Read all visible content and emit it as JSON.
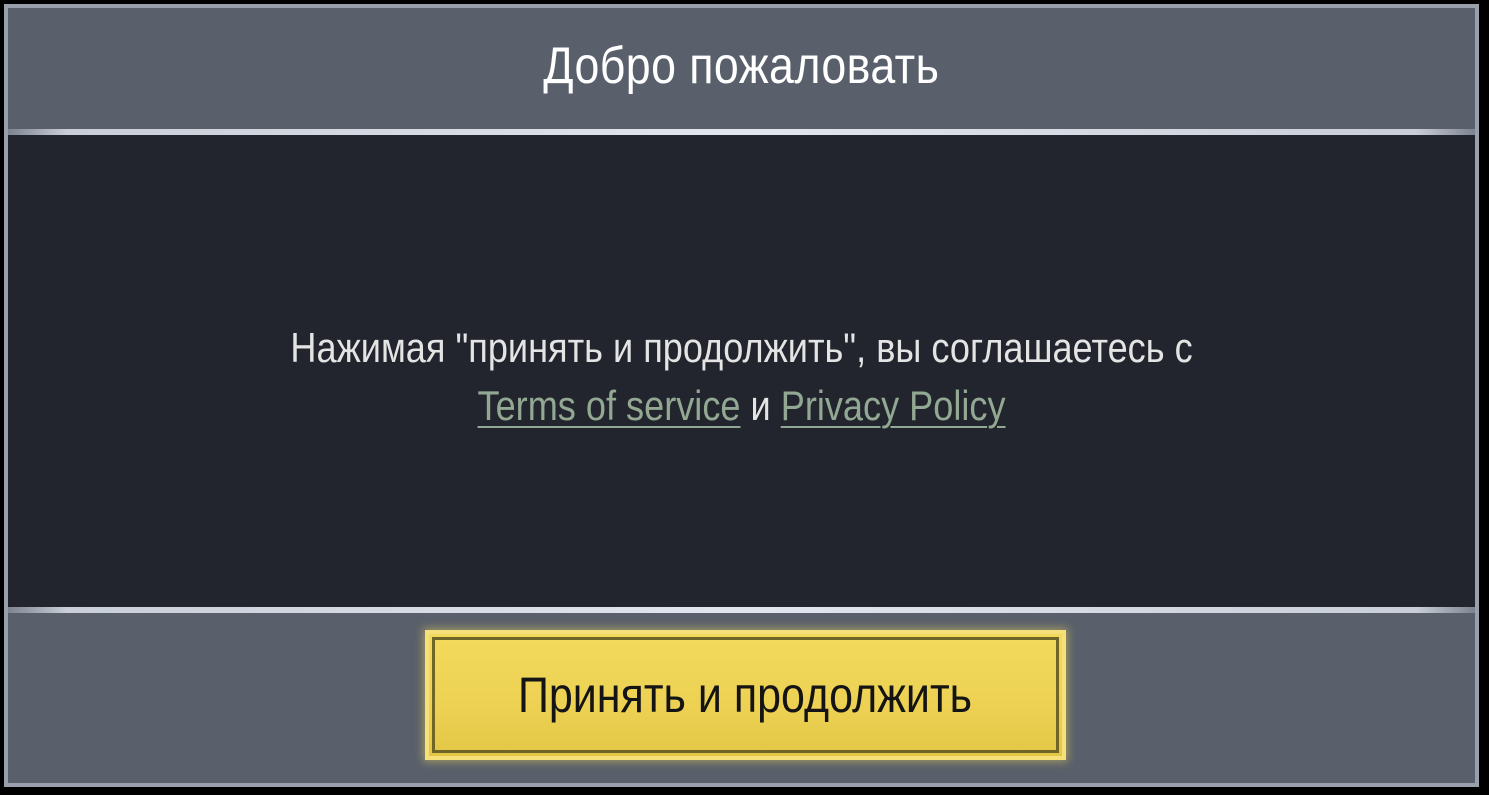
{
  "dialog": {
    "title": "Добро пожаловать",
    "message_prefix": "Нажимая \"принять и продолжить\", вы соглашаетесь с",
    "terms_link": "Terms of service",
    "conjunction": "и",
    "privacy_link": "Privacy Policy",
    "accept_button": "Принять и продолжить"
  },
  "colors": {
    "header_bg": "#5a606b",
    "body_bg": "#22252d",
    "link": "#93a892",
    "button_bg": "#ecd153"
  }
}
